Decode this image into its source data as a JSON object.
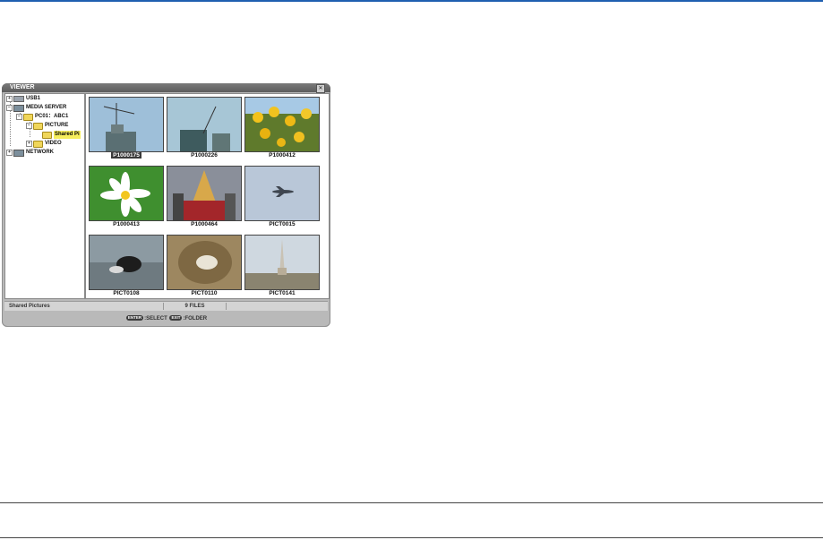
{
  "window": {
    "title": "VIEWER",
    "close_glyph": "✕"
  },
  "tree": {
    "nodes": [
      {
        "label": "USB1",
        "icon": "drive-icon",
        "toggle": "+"
      },
      {
        "label": "MEDIA SERVER",
        "icon": "monitor-icon",
        "toggle": "−"
      },
      {
        "label": "PC01：ABC1",
        "icon": "folder-icon",
        "toggle": "−"
      },
      {
        "label": "PICTURE",
        "icon": "folder-icon",
        "toggle": "−"
      },
      {
        "label": "Shared Pi",
        "icon": "folder-icon",
        "toggle": "",
        "selected": true
      },
      {
        "label": "VIDEO",
        "icon": "folder-icon",
        "toggle": "+"
      },
      {
        "label": "NETWORK",
        "icon": "monitor-icon",
        "toggle": "+"
      }
    ]
  },
  "thumbnails": [
    {
      "name": "P1000175",
      "scene": "crane",
      "selected": true
    },
    {
      "name": "P1000226",
      "scene": "crane2"
    },
    {
      "name": "P1000412",
      "scene": "sunflowers"
    },
    {
      "name": "P1000413",
      "scene": "cosmos"
    },
    {
      "name": "P1000464",
      "scene": "festival"
    },
    {
      "name": "PICT0015",
      "scene": "airplane"
    },
    {
      "name": "PICT0108",
      "scene": "dog"
    },
    {
      "name": "PICT0110",
      "scene": "hole"
    },
    {
      "name": "PICT0141",
      "scene": "tower"
    }
  ],
  "status": {
    "folder": "Shared Pictures",
    "files": "9 FILES"
  },
  "hints": {
    "enter_key": "ENTER",
    "select": ":SELECT",
    "exit_key": "EXIT",
    "folder": ":FOLDER"
  },
  "colors": {
    "accent_rule": "#1f5fb0",
    "selection": "#f6ee5c"
  }
}
